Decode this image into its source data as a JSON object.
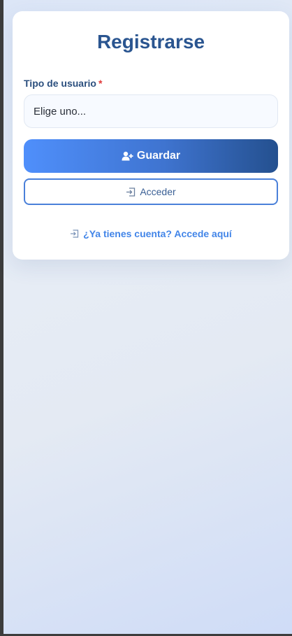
{
  "form": {
    "title": "Registrarse",
    "user_type_label": "Tipo de usuario",
    "required_marker": "*",
    "user_type_value": "Elige uno..."
  },
  "buttons": {
    "save_label": "Guardar",
    "save_icon": "user-plus-icon",
    "login_label": "Acceder",
    "login_icon": "sign-in-icon"
  },
  "footer": {
    "login_link_label": "¿Ya tienes cuenta? Accede aquí",
    "login_link_icon": "sign-in-icon"
  },
  "colors": {
    "title": "#2a5590",
    "accent": "#4285e8",
    "primary_gradient_start": "#4f8ffb",
    "primary_gradient_end": "#24508f",
    "required": "#e03b3b"
  }
}
